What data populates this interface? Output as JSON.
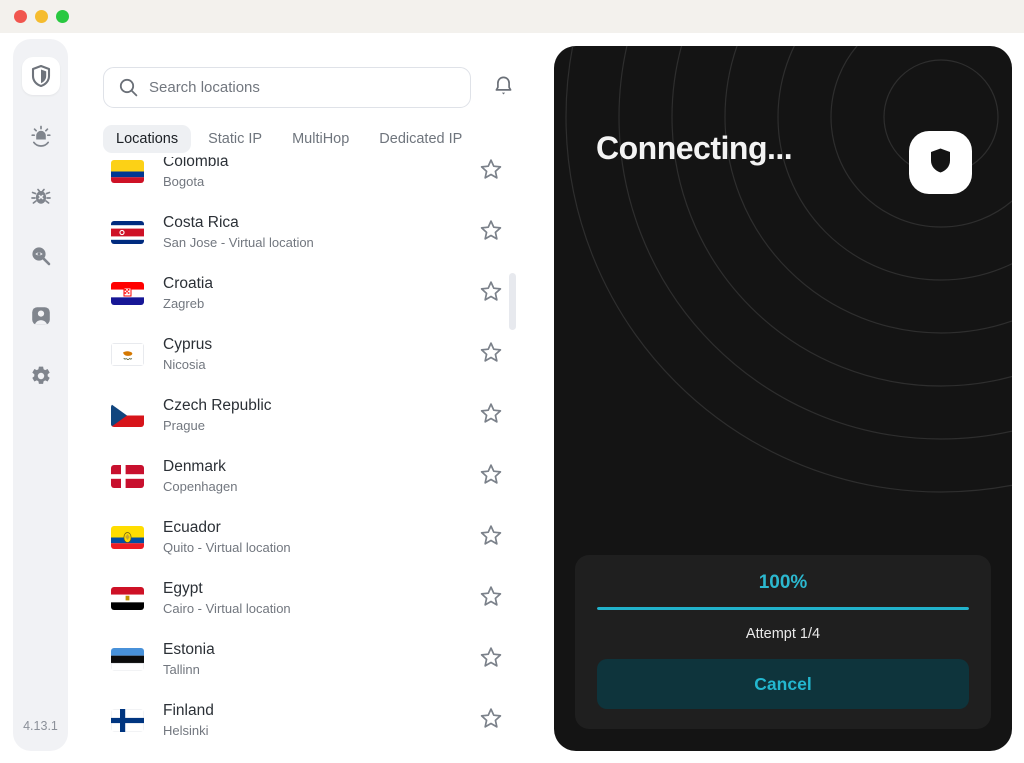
{
  "titlebar": {
    "close_label": "close",
    "minimize_label": "minimize",
    "zoom_label": "zoom"
  },
  "sidebar": {
    "version": "4.13.1",
    "items": [
      {
        "icon": "shield-icon",
        "name": "vpn",
        "active": true
      },
      {
        "icon": "threat-alert-icon",
        "name": "threat-protection",
        "active": false
      },
      {
        "icon": "bug-icon",
        "name": "malware-scan",
        "active": false
      },
      {
        "icon": "dark-web-monitor-icon",
        "name": "dark-web-monitor",
        "active": false
      },
      {
        "icon": "person-icon",
        "name": "profile",
        "active": false
      },
      {
        "icon": "gear-icon",
        "name": "settings",
        "active": false
      }
    ]
  },
  "search": {
    "placeholder": "Search locations",
    "value": "",
    "icon": "search-icon"
  },
  "notifications": {
    "icon": "bell-icon"
  },
  "tabs": [
    {
      "label": "Locations",
      "active": true
    },
    {
      "label": "Static IP",
      "active": false
    },
    {
      "label": "MultiHop",
      "active": false
    },
    {
      "label": "Dedicated IP",
      "active": false
    }
  ],
  "locations": [
    {
      "country": "Colombia",
      "city": "Bogota",
      "flag": "co",
      "favorite": false
    },
    {
      "country": "Costa Rica",
      "city": "San Jose - Virtual location",
      "flag": "cr",
      "favorite": false
    },
    {
      "country": "Croatia",
      "city": "Zagreb",
      "flag": "hr",
      "favorite": false
    },
    {
      "country": "Cyprus",
      "city": "Nicosia",
      "flag": "cy",
      "favorite": false
    },
    {
      "country": "Czech Republic",
      "city": "Prague",
      "flag": "cz",
      "favorite": false
    },
    {
      "country": "Denmark",
      "city": "Copenhagen",
      "flag": "dk",
      "favorite": false
    },
    {
      "country": "Ecuador",
      "city": "Quito - Virtual location",
      "flag": "ec",
      "favorite": false
    },
    {
      "country": "Egypt",
      "city": "Cairo - Virtual location",
      "flag": "eg",
      "favorite": false
    },
    {
      "country": "Estonia",
      "city": "Tallinn",
      "flag": "ee",
      "favorite": false
    },
    {
      "country": "Finland",
      "city": "Helsinki",
      "flag": "fi",
      "favorite": false
    }
  ],
  "connection": {
    "status_title": "Connecting...",
    "badge_icon": "shield-icon",
    "progress_percent_label": "100%",
    "progress_percent_value": 100,
    "attempt_label": "Attempt 1/4",
    "cancel_label": "Cancel",
    "accent_color": "#21b2cb",
    "panel_background": "#141414"
  }
}
